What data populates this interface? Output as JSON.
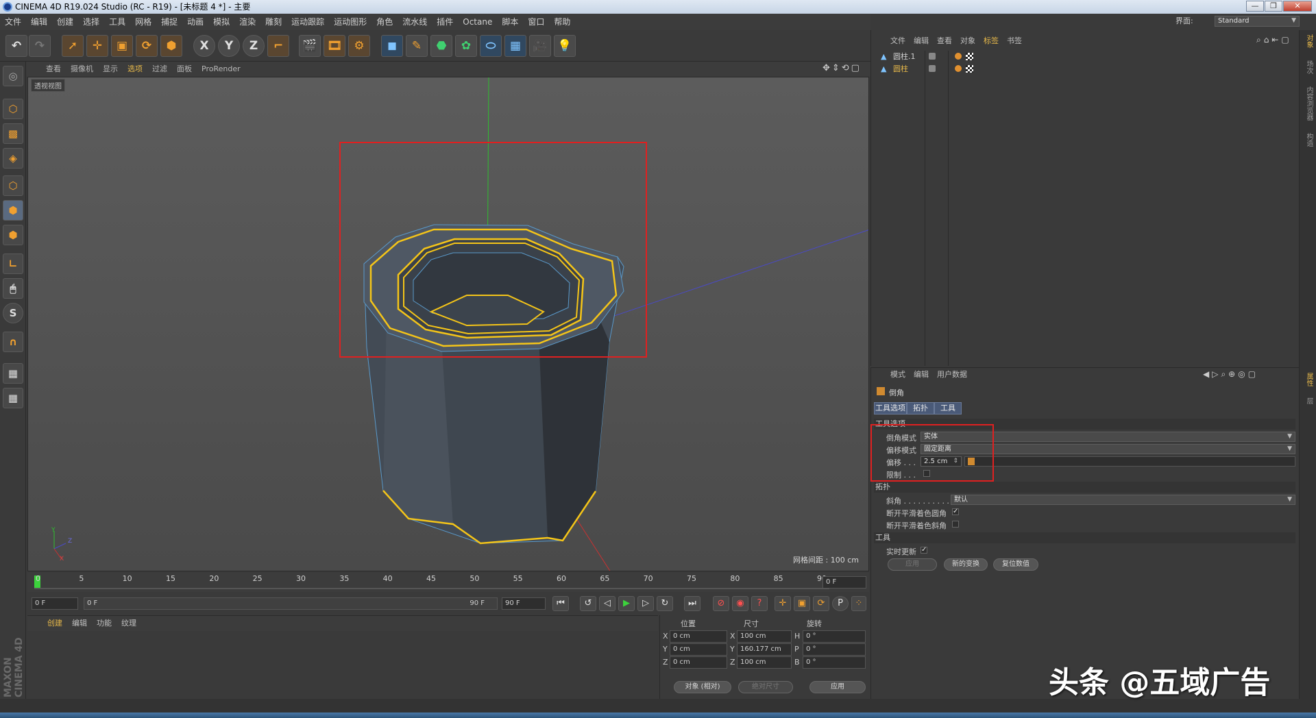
{
  "window": {
    "title": "CINEMA 4D R19.024 Studio (RC - R19) - [未标题 4 *] - 主要",
    "interface_label": "界面:",
    "interface_value": "Standard"
  },
  "menubar": [
    "文件",
    "编辑",
    "创建",
    "选择",
    "工具",
    "网格",
    "捕捉",
    "动画",
    "模拟",
    "渲染",
    "雕刻",
    "运动跟踪",
    "运动图形",
    "角色",
    "流水线",
    "插件",
    "Octane",
    "脚本",
    "窗口",
    "帮助"
  ],
  "toolbar": {
    "axis_x": "X",
    "axis_y": "Y",
    "axis_z": "Z"
  },
  "viewport": {
    "menu": [
      "查看",
      "摄像机",
      "显示",
      "选项",
      "过滤",
      "面板",
      "ProRender"
    ],
    "active_menu": "选项",
    "label": "透视视图",
    "grid_spacing": "网格间距 : 100 cm",
    "axis_y": "Y",
    "axis_z": "Z",
    "axis_x": "X"
  },
  "timeline": {
    "ticks": [
      "0",
      "5",
      "10",
      "15",
      "20",
      "25",
      "30",
      "35",
      "40",
      "45",
      "50",
      "55",
      "60",
      "65",
      "70",
      "75",
      "80",
      "85",
      "90"
    ],
    "current_frame": "0 F",
    "start_frame": "0 F",
    "range_start": "0 F",
    "range_end": "90 F",
    "end_frame": "90 F"
  },
  "material_manager": {
    "menu": [
      "创建",
      "编辑",
      "功能",
      "纹理"
    ],
    "brand": "MAXON CINEMA 4D"
  },
  "coordinates": {
    "headers": [
      "位置",
      "尺寸",
      "旋转"
    ],
    "rows": [
      {
        "axis": "X",
        "pos": "0 cm",
        "size_axis": "X",
        "size": "100 cm",
        "rot_axis": "H",
        "rot": "0 °"
      },
      {
        "axis": "Y",
        "pos": "0 cm",
        "size_axis": "Y",
        "size": "160.177 cm",
        "rot_axis": "P",
        "rot": "0 °"
      },
      {
        "axis": "Z",
        "pos": "0 cm",
        "size_axis": "Z",
        "size": "100 cm",
        "rot_axis": "B",
        "rot": "0 °"
      }
    ],
    "mode": "对象 (相对)",
    "size_mode": "绝对尺寸",
    "apply": "应用"
  },
  "object_manager": {
    "menu": [
      "文件",
      "编辑",
      "查看",
      "对象",
      "标签",
      "书签"
    ],
    "active_menu": "标签",
    "objects": [
      {
        "name": "圆柱.1",
        "selected": false
      },
      {
        "name": "圆柱",
        "selected": true
      }
    ]
  },
  "attribute_manager": {
    "menu": [
      "模式",
      "编辑",
      "用户数据"
    ],
    "tool_name": "倒角",
    "tabs": [
      "工具选项",
      "拓扑",
      "工具"
    ],
    "section_tool_options": "工具选项",
    "bevel_mode_label": "倒角模式",
    "bevel_mode_value": "实体",
    "offset_mode_label": "偏移模式",
    "offset_mode_value": "固定距离",
    "offset_label": "偏移 . . .",
    "offset_value": "2.5 cm",
    "limit_label": "限制 . . .",
    "section_topology": "拓扑",
    "miter_label": "斜角 . . . . . . . . . .",
    "miter_value": "默认",
    "break_round_label": "断开平滑着色圆角",
    "break_round_checked": "✓",
    "break_miter_label": "断开平滑着色斜角",
    "section_tool": "工具",
    "realtime_label": "实时更新",
    "realtime_checked": "✓",
    "apply_button": "应用",
    "new_transform_button": "新的变换",
    "reset_button": "复位数值"
  },
  "right_tabs": [
    "对象",
    "场次",
    "内容浏览器",
    "构造",
    "属性",
    "层"
  ],
  "watermark": "头条 @五域广告",
  "colors": {
    "selection_yellow": "#f5c518",
    "highlight_red": "#e02020",
    "active_menu": "#e6b84a"
  }
}
